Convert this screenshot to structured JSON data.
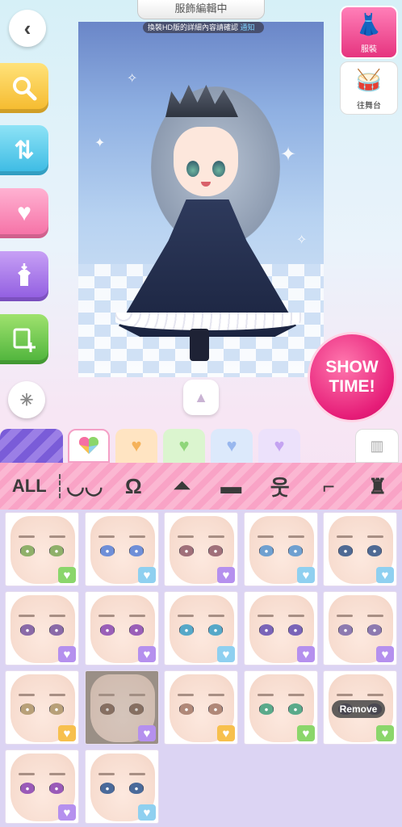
{
  "header": {
    "title": "服飾編輯中"
  },
  "stage": {
    "hint_text": "換裝HD版的詳細內容請確認",
    "hint_link": "通知"
  },
  "left_buttons": [
    {
      "name": "back",
      "icon": "back-icon"
    },
    {
      "name": "search",
      "icon": "search-icon"
    },
    {
      "name": "sort",
      "icon": "sort-icon"
    },
    {
      "name": "favorite-add",
      "icon": "heart-plus-icon"
    },
    {
      "name": "outfit-save",
      "icon": "outfit-download-icon"
    },
    {
      "name": "add-item",
      "icon": "add-icon"
    }
  ],
  "right_tabs": {
    "dress_label": "服裝",
    "stage_label": "往舞台"
  },
  "show_time": {
    "line1": "SHOW",
    "line2": "TIME!"
  },
  "color_tabs": [
    "stripe",
    "multi",
    "orange",
    "green",
    "blue",
    "purple"
  ],
  "categories": {
    "all_label": "ALL"
  },
  "colors": {
    "accent_pink": "#e61d78",
    "category_bar": "#f9a3c6",
    "grid_bg": "#dcd4f3"
  },
  "tiles": [
    {
      "eye": "#8fb06a",
      "heart": "green"
    },
    {
      "eye": "#6f8fd8",
      "heart": "blue"
    },
    {
      "eye": "#a0707a",
      "heart": "purple"
    },
    {
      "eye": "#6fa0d0",
      "heart": "blue"
    },
    {
      "eye": "#4f6a94",
      "heart": "blue"
    },
    {
      "eye": "#8a6aa8",
      "heart": "purple"
    },
    {
      "eye": "#9a5fb8",
      "heart": "purple"
    },
    {
      "eye": "#56a8c8",
      "heart": "blue"
    },
    {
      "eye": "#7a64b8",
      "heart": "purple"
    },
    {
      "eye": "#8d7ab0",
      "heart": "purple"
    },
    {
      "eye": "#b8a078",
      "heart": "orange"
    },
    {
      "eye": "#7a5a4a",
      "heart": "purple",
      "selected": true
    },
    {
      "eye": "#b08878",
      "heart": "orange"
    },
    {
      "eye": "#5aaa8a",
      "heart": "green"
    },
    {
      "eye": "#5a4a8a",
      "heart": "green",
      "remove": true
    },
    {
      "eye": "#9a5ab8",
      "heart": "purple"
    },
    {
      "eye": "#4a6a9a",
      "heart": "blue"
    }
  ],
  "remove_label": "Remove"
}
